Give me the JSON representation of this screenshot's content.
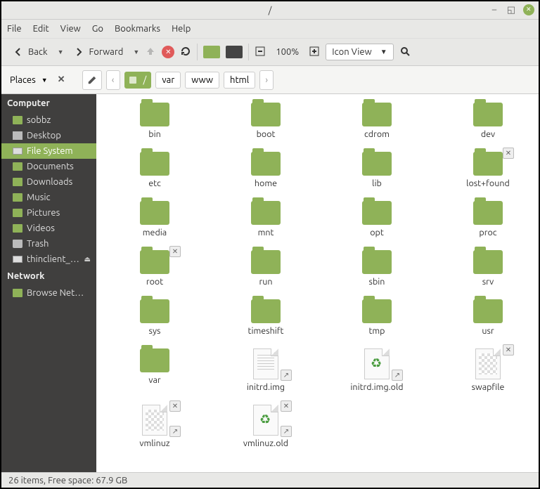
{
  "title": "/",
  "menubar": [
    "File",
    "Edit",
    "View",
    "Go",
    "Bookmarks",
    "Help"
  ],
  "toolbar": {
    "back": "Back",
    "forward": "Forward",
    "zoom": "100%",
    "view_mode": "Icon View"
  },
  "pathbar": {
    "places_label": "Places",
    "crumbs": [
      "/",
      "var",
      "www",
      "html"
    ]
  },
  "sidebar": {
    "computer_header": "Computer",
    "network_header": "Network",
    "computer_items": [
      {
        "label": "sobbz",
        "icon": "folder"
      },
      {
        "label": "Desktop",
        "icon": "gray"
      },
      {
        "label": "File System",
        "icon": "drive",
        "selected": true
      },
      {
        "label": "Documents",
        "icon": "folder"
      },
      {
        "label": "Downloads",
        "icon": "folder"
      },
      {
        "label": "Music",
        "icon": "folder"
      },
      {
        "label": "Pictures",
        "icon": "folder"
      },
      {
        "label": "Videos",
        "icon": "folder"
      },
      {
        "label": "Trash",
        "icon": "trash"
      },
      {
        "label": "thinclient_d…",
        "icon": "drive",
        "eject": true
      }
    ],
    "network_items": [
      {
        "label": "Browse Network",
        "icon": "folder"
      }
    ]
  },
  "files": [
    {
      "name": "bin",
      "type": "folder"
    },
    {
      "name": "boot",
      "type": "folder"
    },
    {
      "name": "cdrom",
      "type": "folder"
    },
    {
      "name": "dev",
      "type": "folder"
    },
    {
      "name": "etc",
      "type": "folder"
    },
    {
      "name": "home",
      "type": "folder"
    },
    {
      "name": "lib",
      "type": "folder"
    },
    {
      "name": "lost+found",
      "type": "folder",
      "emblem": "x"
    },
    {
      "name": "media",
      "type": "folder"
    },
    {
      "name": "mnt",
      "type": "folder"
    },
    {
      "name": "opt",
      "type": "folder"
    },
    {
      "name": "proc",
      "type": "folder"
    },
    {
      "name": "root",
      "type": "folder",
      "emblem": "x"
    },
    {
      "name": "run",
      "type": "folder"
    },
    {
      "name": "sbin",
      "type": "folder"
    },
    {
      "name": "srv",
      "type": "folder"
    },
    {
      "name": "sys",
      "type": "folder"
    },
    {
      "name": "timeshift",
      "type": "folder"
    },
    {
      "name": "tmp",
      "type": "folder"
    },
    {
      "name": "usr",
      "type": "folder"
    },
    {
      "name": "var",
      "type": "folder"
    },
    {
      "name": "initrd.img",
      "type": "file-text",
      "emblem": "link"
    },
    {
      "name": "initrd.img.old",
      "type": "file-recycle",
      "emblem": "link"
    },
    {
      "name": "swapfile",
      "type": "file-checker",
      "emblem": "x"
    },
    {
      "name": "vmlinuz",
      "type": "file-checker",
      "emblem": "xlink"
    },
    {
      "name": "vmlinuz.old",
      "type": "file-recycle",
      "emblem": "xlink"
    }
  ],
  "status": "26 items, Free space: 67.9 GB"
}
